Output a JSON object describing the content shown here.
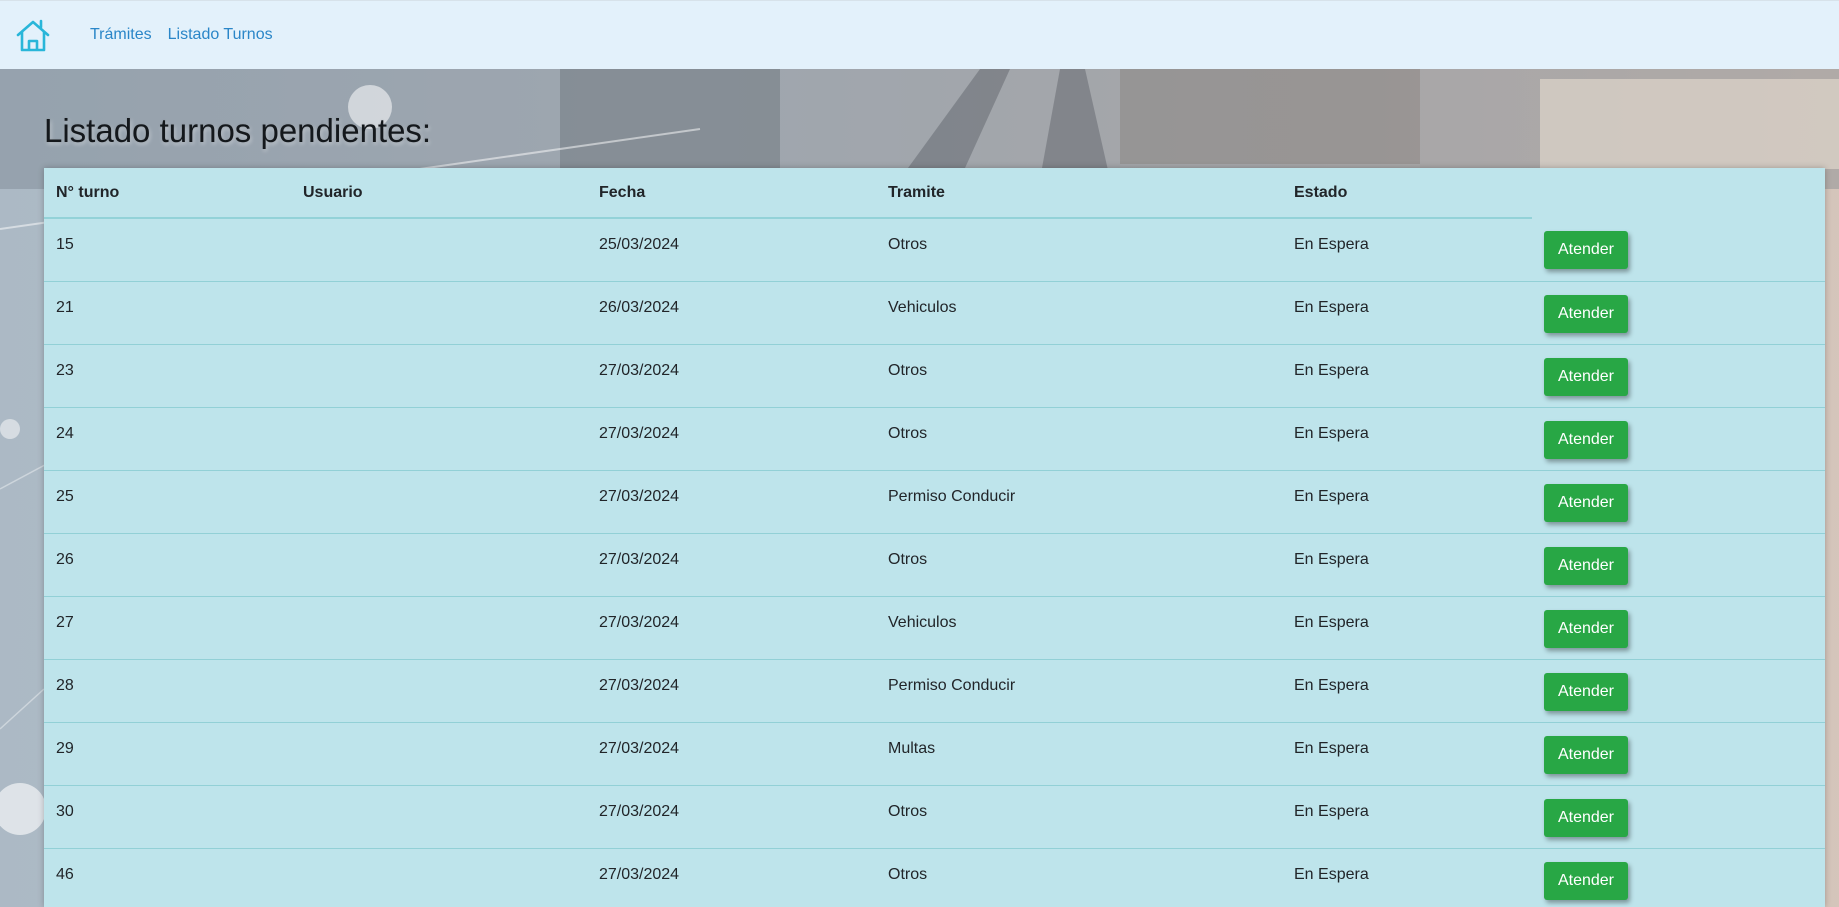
{
  "nav": {
    "home_icon": "home-icon",
    "links": [
      "Trámites",
      "Listado Turnos"
    ]
  },
  "page": {
    "title": "Listado turnos pendientes:"
  },
  "table": {
    "headers": {
      "turno": "N° turno",
      "usuario": "Usuario",
      "fecha": "Fecha",
      "tramite": "Tramite",
      "estado": "Estado"
    },
    "action_label": "Atender",
    "rows": [
      {
        "turno": "15",
        "usuario": "",
        "fecha": "25/03/2024",
        "tramite": "Otros",
        "estado": "En Espera"
      },
      {
        "turno": "21",
        "usuario": "",
        "fecha": "26/03/2024",
        "tramite": "Vehiculos",
        "estado": "En Espera"
      },
      {
        "turno": "23",
        "usuario": "",
        "fecha": "27/03/2024",
        "tramite": "Otros",
        "estado": "En Espera"
      },
      {
        "turno": "24",
        "usuario": "",
        "fecha": "27/03/2024",
        "tramite": "Otros",
        "estado": "En Espera"
      },
      {
        "turno": "25",
        "usuario": "",
        "fecha": "27/03/2024",
        "tramite": "Permiso Conducir",
        "estado": "En Espera"
      },
      {
        "turno": "26",
        "usuario": "",
        "fecha": "27/03/2024",
        "tramite": "Otros",
        "estado": "En Espera"
      },
      {
        "turno": "27",
        "usuario": "",
        "fecha": "27/03/2024",
        "tramite": "Vehiculos",
        "estado": "En Espera"
      },
      {
        "turno": "28",
        "usuario": "",
        "fecha": "27/03/2024",
        "tramite": "Permiso Conducir",
        "estado": "En Espera"
      },
      {
        "turno": "29",
        "usuario": "",
        "fecha": "27/03/2024",
        "tramite": "Multas",
        "estado": "En Espera"
      },
      {
        "turno": "30",
        "usuario": "",
        "fecha": "27/03/2024",
        "tramite": "Otros",
        "estado": "En Espera"
      },
      {
        "turno": "46",
        "usuario": "",
        "fecha": "27/03/2024",
        "tramite": "Otros",
        "estado": "En Espera"
      }
    ]
  },
  "colors": {
    "navbar_bg": "#e3f1fb",
    "link": "#2a86c8",
    "table_bg": "#bee4eb",
    "button_bg": "#28a745",
    "icon": "#29b6d9"
  }
}
